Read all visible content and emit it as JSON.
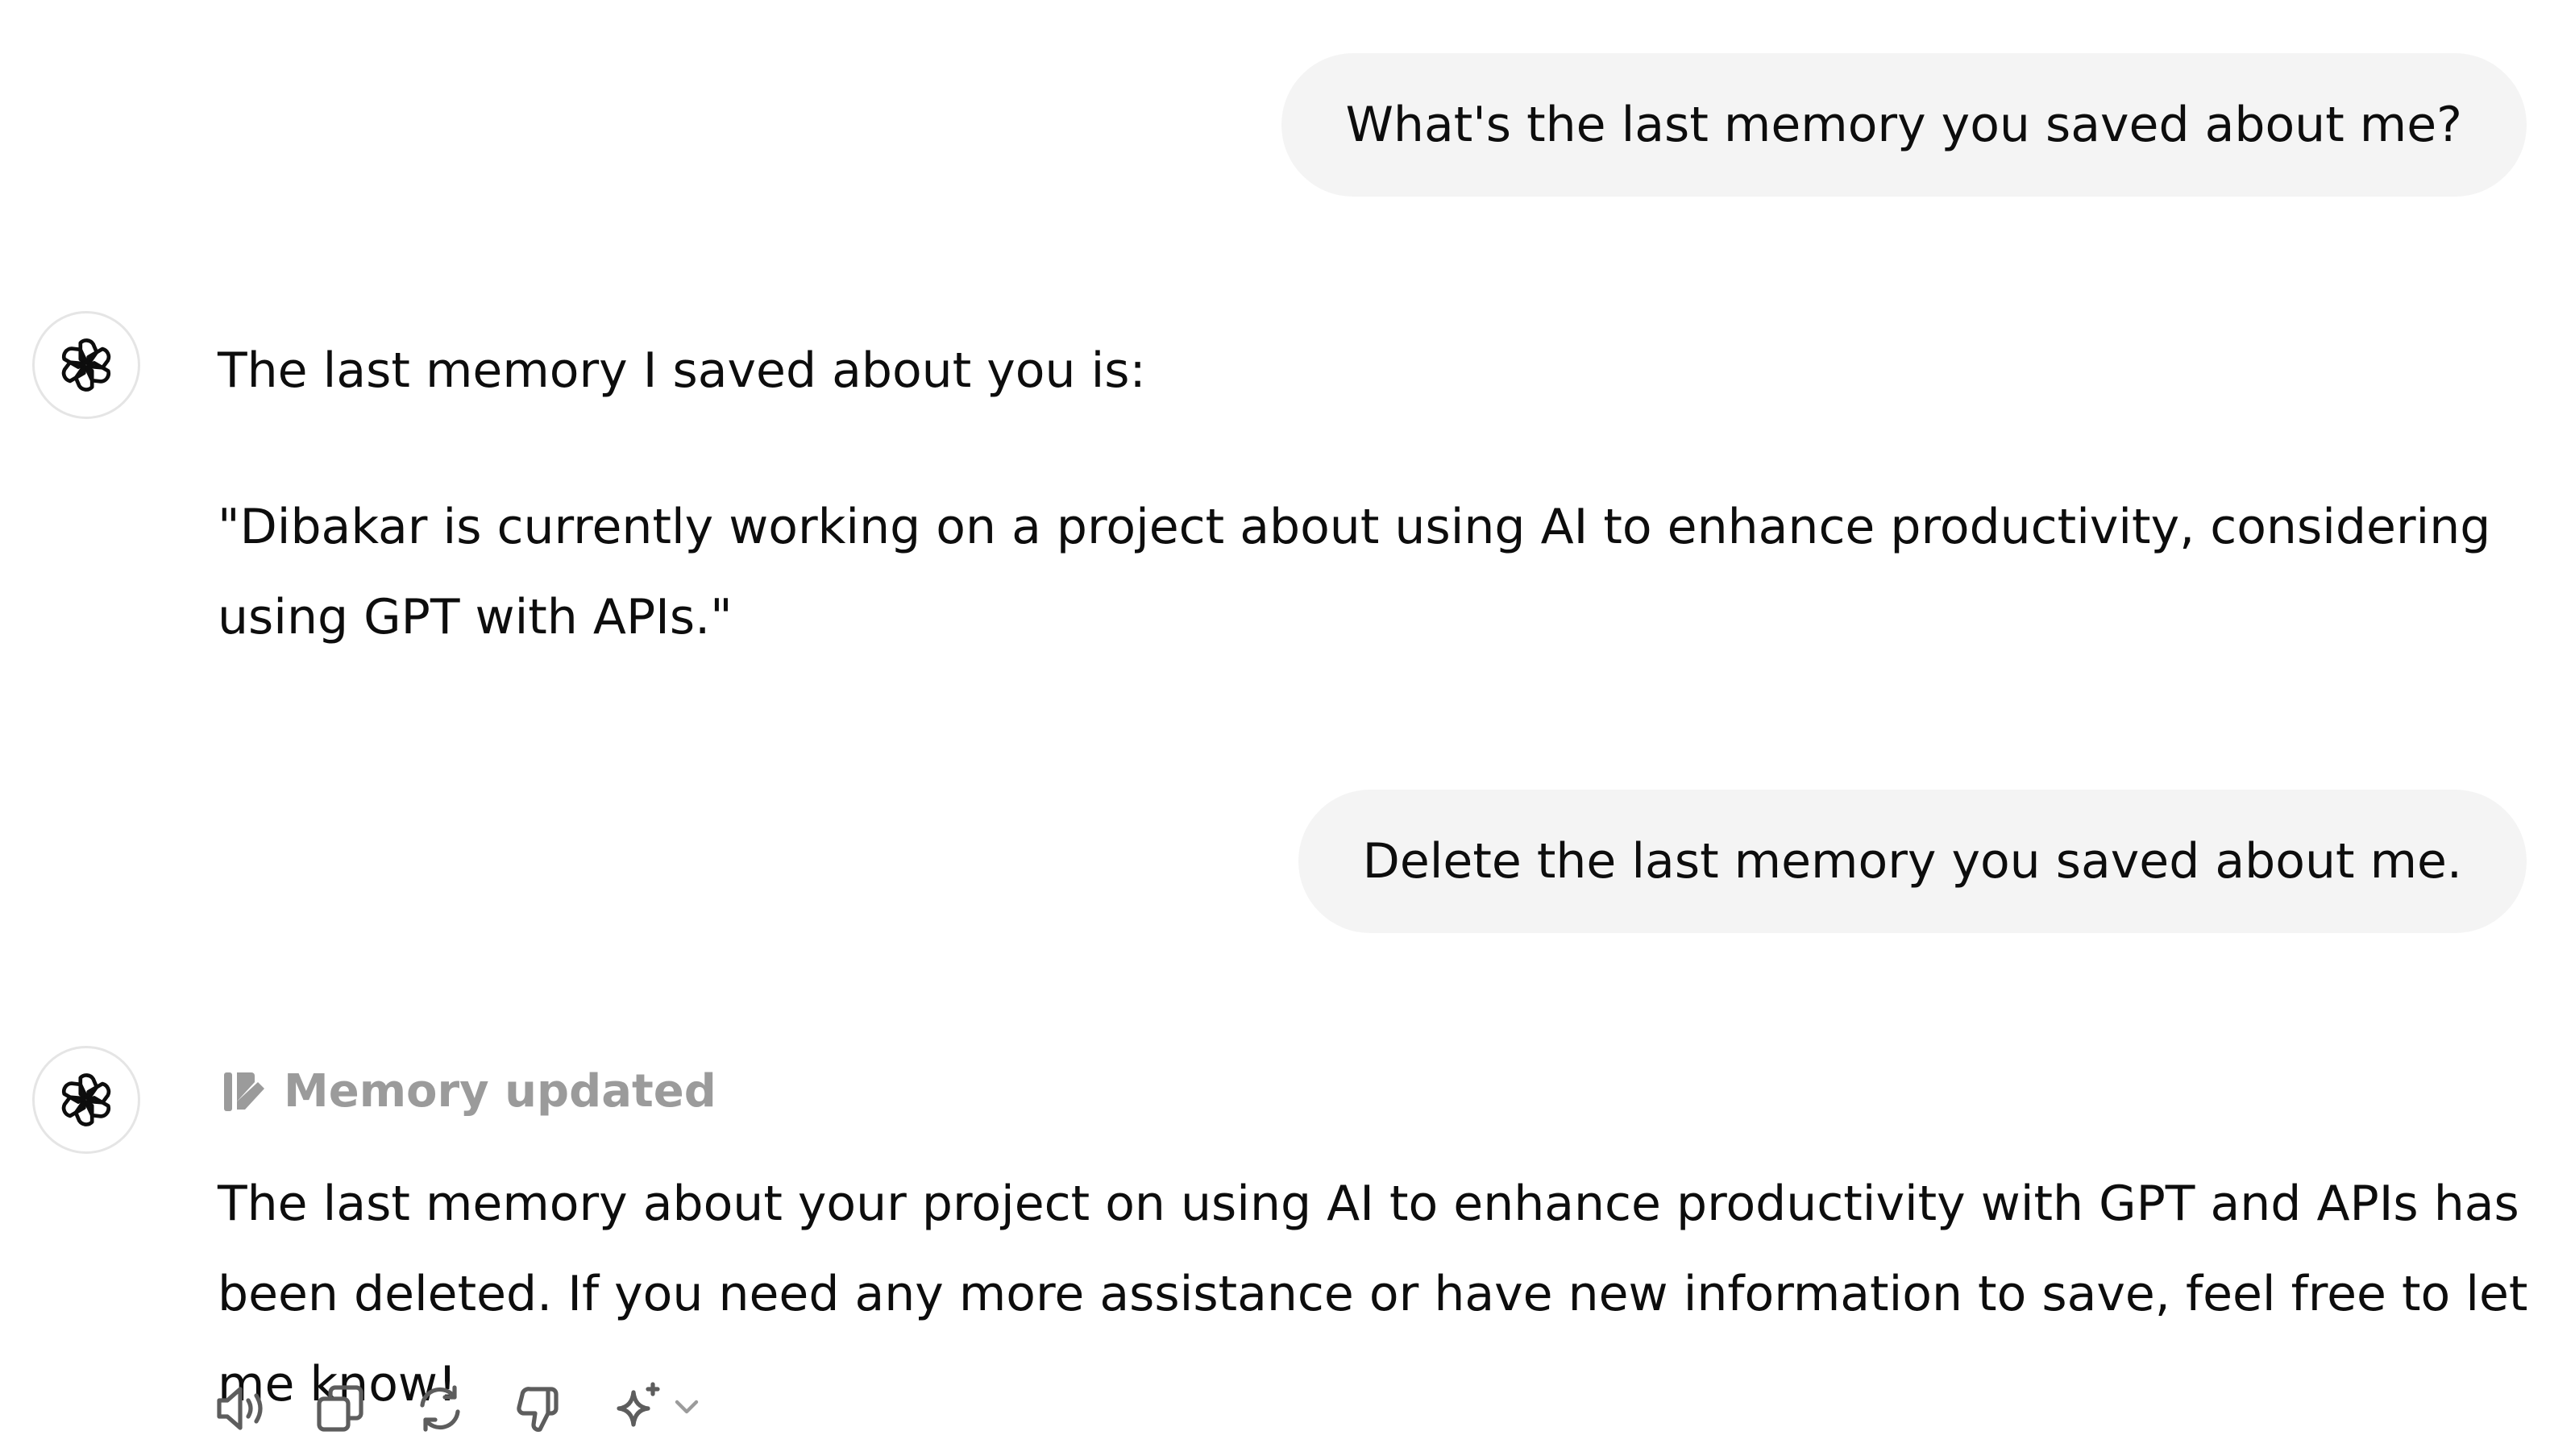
{
  "conversation": {
    "user_messages": [
      "What's the last memory you saved about me?",
      "Delete the last memory you saved about me."
    ],
    "assistant_1": {
      "intro": "The last memory I saved about you is:",
      "quote": "\"Dibakar is currently working on a project about using AI to enhance productivity, considering using GPT with APIs.\""
    },
    "assistant_2": {
      "memory_label": "Memory updated",
      "text": "The last memory about your project on using AI to enhance productivity with GPT and APIs has been deleted. If you need any more assistance or have new information to save, feel free to let me know!"
    }
  },
  "icons": {
    "avatar": "openai-logo-icon",
    "memory": "memory-edit-icon",
    "actions": [
      "speaker-icon",
      "copy-icon",
      "regenerate-icon",
      "thumbs-down-icon",
      "sparkle-icon",
      "chevron-down-icon"
    ]
  },
  "colors": {
    "user_bubble": "#f4f4f4",
    "muted_text": "#9b9b9b",
    "icon": "#5d5d5d"
  }
}
